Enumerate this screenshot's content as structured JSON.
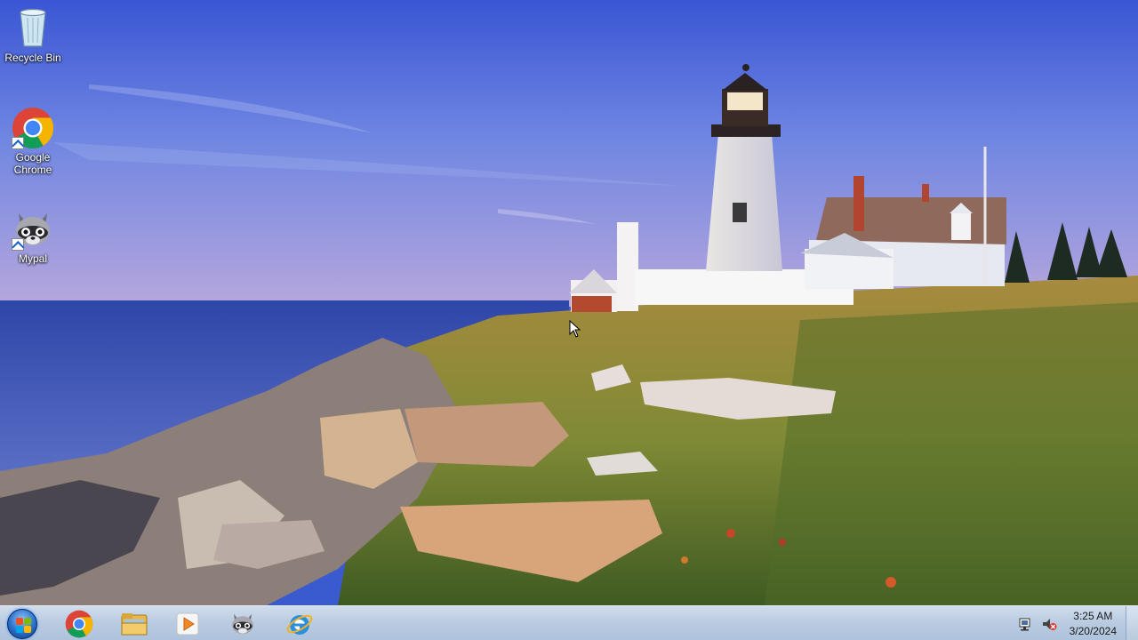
{
  "desktop": {
    "icons": [
      {
        "label": "Recycle Bin",
        "icon": "recycle-bin-icon"
      },
      {
        "label": "Google\nChrome",
        "label_line1": "Google",
        "label_line2": "Chrome",
        "icon": "chrome-icon"
      },
      {
        "label": "Mypal",
        "icon": "mypal-raccoon-icon"
      }
    ]
  },
  "taskbar": {
    "start": {
      "icon": "windows-logo-icon"
    },
    "pinned": [
      {
        "name": "Google Chrome",
        "icon": "chrome-icon"
      },
      {
        "name": "Windows Explorer",
        "icon": "folder-icon"
      },
      {
        "name": "Windows Media Player",
        "icon": "media-player-icon"
      },
      {
        "name": "Mypal",
        "icon": "mypal-raccoon-icon"
      },
      {
        "name": "Internet Explorer",
        "icon": "internet-explorer-icon"
      }
    ],
    "tray": {
      "network_icon": "network-icon",
      "volume_icon": "volume-muted-icon",
      "time": "3:25 AM",
      "date": "3/20/2024"
    }
  },
  "colors": {
    "taskbar": "#b9cbe0",
    "sky_top": "#3c5fd6",
    "sea": "#2b3f8f"
  }
}
